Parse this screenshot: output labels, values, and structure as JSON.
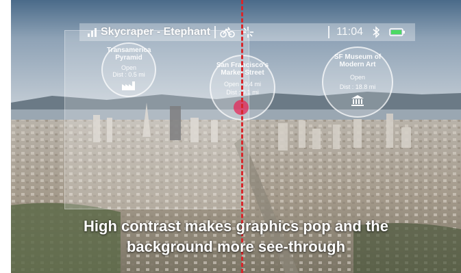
{
  "hud": {
    "title": "Skycraper - Etephant",
    "time": "11:04",
    "icons": [
      "signal-bars-icon",
      "bicycle-icon",
      "compass-icon",
      "bluetooth-icon",
      "battery-icon"
    ],
    "accent": "#ffffff"
  },
  "pois": [
    {
      "name": "Transamerica Pyramid",
      "status": "Open",
      "dist": "Dist : 0.5 mi",
      "icon": "factory-icon"
    },
    {
      "name": "San Francisco's Market Street",
      "status": "Open : 0.4 mi",
      "dist": "Dist : 0.1 mi",
      "icon": ""
    },
    {
      "name": "SF Museum of Modern Art",
      "status": "Open",
      "dist": "Dist : 18.8 mi",
      "icon": "museum-icon"
    }
  ],
  "caption": {
    "line1": "High contrast makes graphics pop and the",
    "line2": "background more see-through"
  },
  "colors": {
    "divider": "#d8262b",
    "sky_top": "#4c6c8c",
    "sky_bottom": "#b9c6d2"
  }
}
